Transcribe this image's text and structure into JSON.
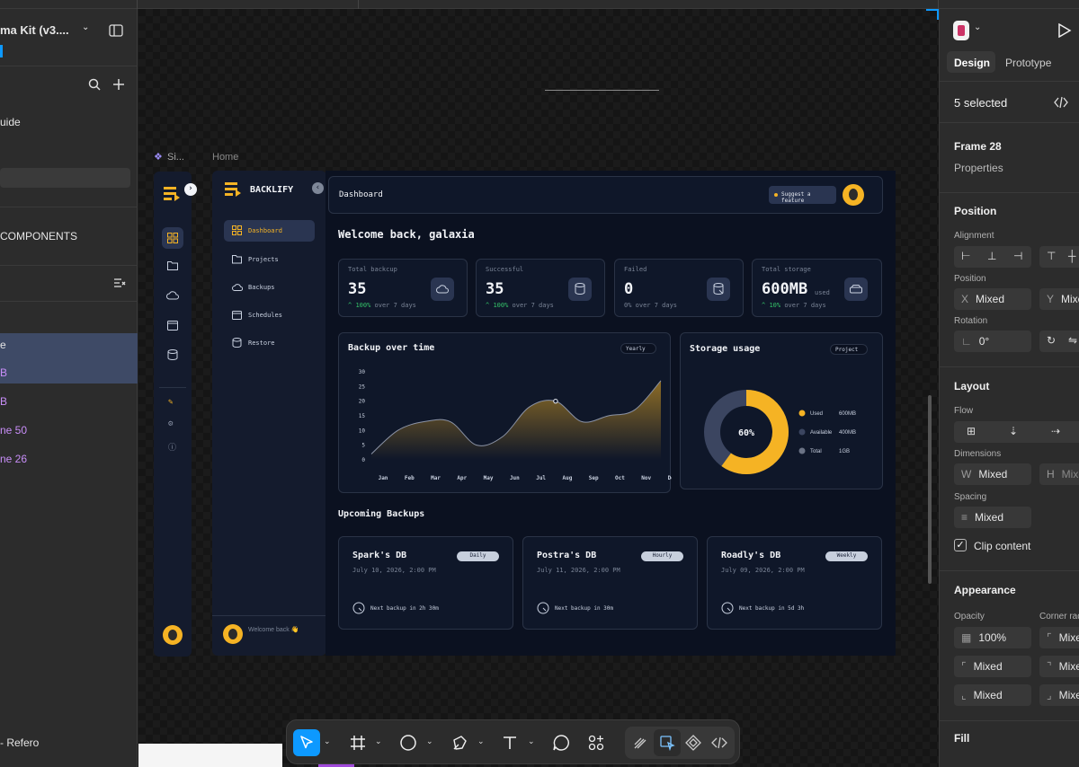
{
  "editor": {
    "file_title": "ma Kit (v3....",
    "file_subtitle": "",
    "left_items": {
      "guide": "uide",
      "components": "COMPONENTS",
      "layer_home": "e",
      "layer_b1": "B",
      "layer_b2": "B",
      "layer_frame50": "ne 50",
      "layer_frame26": "ne 26",
      "bottom": "- Refero"
    },
    "canvas": {
      "frame_label_rail": "Si...",
      "frame_label_home": "Home"
    },
    "right": {
      "tab_design": "Design",
      "tab_prototype": "Prototype",
      "selection": "5 selected",
      "frame_name": "Frame 28",
      "properties": "Properties",
      "position_h": "Position",
      "alignment_l": "Alignment",
      "position_l": "Position",
      "x_lbl": "X",
      "x_val": "Mixed",
      "y_lbl": "Y",
      "y_val": "Mixe",
      "rotation_l": "Rotation",
      "rotation_val": "0°",
      "layout_h": "Layout",
      "flow_l": "Flow",
      "dimensions_l": "Dimensions",
      "w_lbl": "W",
      "w_val": "Mixed",
      "h_lbl": "H",
      "h_val": "Mixe",
      "spacing_l": "Spacing",
      "spacing_val": "Mixed",
      "clip": "Clip content",
      "appearance_h": "Appearance",
      "opacity_l": "Opacity",
      "opacity_val": "100%",
      "corner_l": "Corner rad",
      "corner_val": "Mixe",
      "r1": "Mixed",
      "r2": "Mixe",
      "r3": "Mixed",
      "r4": "Mixe",
      "fill_h": "Fill"
    }
  },
  "app": {
    "brand": "BACKLIFY",
    "nav": [
      "Dashboard",
      "Projects",
      "Backups",
      "Schedules",
      "Restore"
    ],
    "welcome_back_small": "Welcome back 👋",
    "header_title": "Dashboard",
    "suggest": "Suggest a feature",
    "greeting": "Welcome back, galaxia",
    "stats": [
      {
        "label": "Total backcup",
        "value": "35",
        "unit": "",
        "delta": "100%",
        "delta_text": "over 7 days",
        "icon": "cloud-upload-icon"
      },
      {
        "label": "Successful",
        "value": "35",
        "unit": "",
        "delta": "100%",
        "delta_text": "over 7 days",
        "icon": "database-icon"
      },
      {
        "label": "Failed",
        "value": "0",
        "unit": "",
        "delta": "0%",
        "delta_text": "over 7 days",
        "icon": "database-error-icon"
      },
      {
        "label": "Total storage",
        "value": "600MB",
        "unit": "used",
        "delta": "10%",
        "delta_text": "over 7 days",
        "icon": "hard-drive-icon"
      }
    ],
    "backup_chart": {
      "title": "Backup over time",
      "filter": "Yearly"
    },
    "storage_chart": {
      "title": "Storage usage",
      "filter": "Project",
      "center": "60%"
    },
    "upcoming_title": "Upcoming Backups",
    "upcoming": [
      {
        "name": "Spark's DB",
        "date": "July 10, 2026, 2:00 PM",
        "badge": "Daily",
        "next": "Next backup in 2h 30m"
      },
      {
        "name": "Postra's DB",
        "date": "July 11, 2026, 2:00 PM",
        "badge": "Hourly",
        "next": "Next backup in 30m"
      },
      {
        "name": "Roadly's DB",
        "date": "July 09, 2026, 2:00 PM",
        "badge": "Weekly",
        "next": "Next backup in 5d 3h"
      }
    ]
  },
  "chart_data": [
    {
      "type": "area",
      "title": "Backup over time",
      "categories": [
        "Jan",
        "Feb",
        "Mar",
        "Apr",
        "May",
        "Jun",
        "Jul",
        "Aug",
        "Sep",
        "Oct",
        "Nov",
        "Dec"
      ],
      "values": [
        2,
        10,
        13,
        13,
        5,
        8,
        18,
        20,
        13,
        15,
        17,
        27
      ],
      "yticks": [
        0,
        5,
        10,
        15,
        20,
        25,
        30
      ],
      "ylim": [
        0,
        30
      ],
      "highlight_index": 7,
      "color": "#f5b324"
    },
    {
      "type": "pie",
      "title": "Storage usage",
      "slices": [
        {
          "label": "Used",
          "value_text": "600MB",
          "value": 600,
          "color": "#f5b324"
        },
        {
          "label": "Available",
          "value_text": "400MB",
          "value": 400,
          "color": "#3b4560"
        },
        {
          "label": "Total",
          "value_text": "1GB",
          "value": null,
          "color": "#6b7385"
        }
      ]
    }
  ]
}
